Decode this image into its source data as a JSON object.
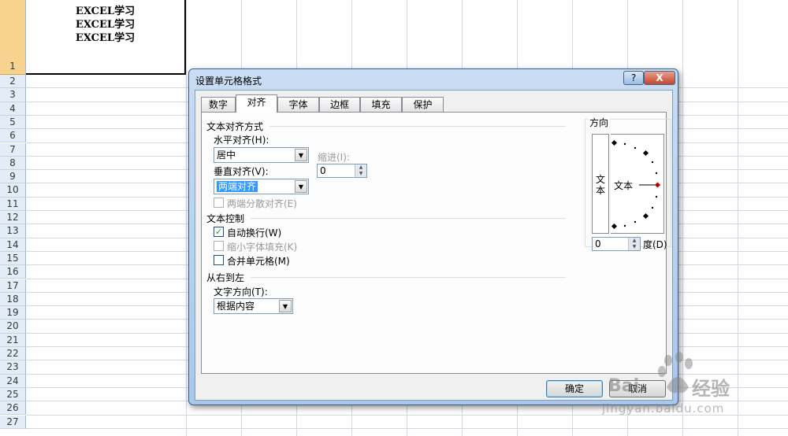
{
  "sheet": {
    "rows": [
      "1",
      "2",
      "3",
      "4",
      "5",
      "6",
      "7",
      "8",
      "9",
      "10",
      "11",
      "12",
      "13",
      "14",
      "15",
      "16",
      "17",
      "18",
      "19",
      "20",
      "21",
      "22",
      "23",
      "24",
      "25",
      "26",
      "27"
    ],
    "cell_a1_lines": [
      "EXCEL学习",
      "EXCEL学习",
      "EXCEL学习"
    ]
  },
  "dialog": {
    "title": "设置单元格格式",
    "help": "?",
    "close": "X",
    "tabs": [
      "数字",
      "对齐",
      "字体",
      "边框",
      "填充",
      "保护"
    ],
    "active_tab": "对齐",
    "align_group": "文本对齐方式",
    "horizontal_label": "水平对齐(H):",
    "horizontal_value": "居中",
    "indent_label": "缩进(I):",
    "indent_value": "0",
    "vertical_label": "垂直对齐(V):",
    "vertical_value": "两端对齐",
    "distributed_label": "两端分散对齐(E)",
    "control_group": "文本控制",
    "wrap_label": "自动换行(W)",
    "wrap_checked": true,
    "shrink_label": "缩小字体填充(K)",
    "merge_label": "合并单元格(M)",
    "rtl_group": "从右到左",
    "direction_label": "文字方向(T):",
    "direction_value": "根据内容",
    "orientation_group": "方向",
    "orientation_vertical_text": "文本",
    "orientation_dial_text": "文本",
    "degrees_value": "0",
    "degrees_label": "度(D)",
    "ok": "确定",
    "cancel": "取消"
  },
  "watermark": {
    "brand": "Bai",
    "brand2": "经验",
    "url": "jingyan.baidu.com"
  },
  "colors": {
    "accent": "#3399ff",
    "header_selected": "#f8d28f",
    "dial_marker": "#c00000"
  }
}
